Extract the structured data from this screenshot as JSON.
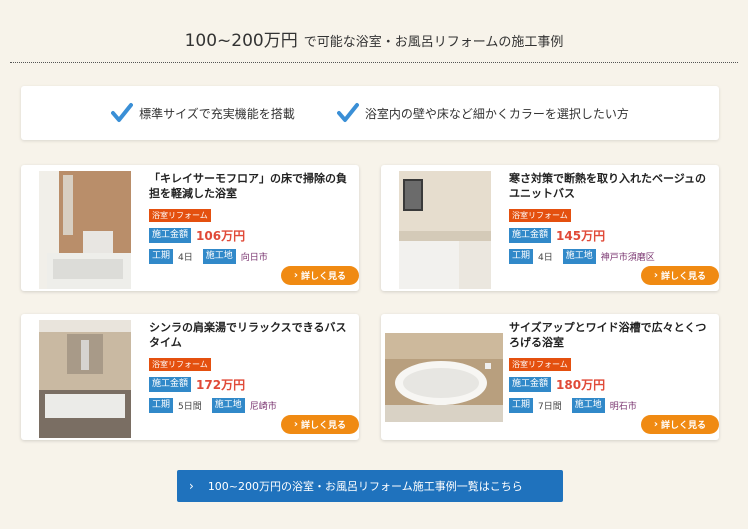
{
  "heading": {
    "price": "100~200万円",
    "text": "で可能な浴室・お風呂リフォームの施工事例"
  },
  "features": [
    {
      "icon": "check-icon",
      "text": "標準サイズで充実機能を搭載"
    },
    {
      "icon": "check-icon",
      "text": "浴室内の壁や床など細かくカラーを選択したい方"
    }
  ],
  "labels": {
    "amount": "施工金額",
    "period": "工期",
    "location": "施工地",
    "more": "詳しく見る"
  },
  "cases": [
    {
      "title": "「キレイサーモフロア」の床で掃除の負担を軽減した浴室",
      "tag": "浴室リフォーム",
      "price": "106万円",
      "period": "4日",
      "location": "向日市"
    },
    {
      "title": "寒さ対策で断熱を取り入れたベージュのユニットバス",
      "tag": "浴室リフォーム",
      "price": "145万円",
      "period": "4日",
      "location": "神戸市須磨区"
    },
    {
      "title": "シンラの肩楽湯でリラックスできるバスタイム",
      "tag": "浴室リフォーム",
      "price": "172万円",
      "period": "5日間",
      "location": "尼崎市"
    },
    {
      "title": "サイズアップとワイド浴槽で広々とくつろげる浴室",
      "tag": "浴室リフォーム",
      "price": "180万円",
      "period": "7日間",
      "location": "明石市"
    }
  ],
  "cta": {
    "text": "100~200万円の浴室・お風呂リフォーム施工事例一覧はこちら"
  },
  "colors": {
    "accent_blue": "#3189c9",
    "tag_orange": "#e4500f",
    "button_orange": "#f08a12",
    "price_red": "#e04a38"
  }
}
